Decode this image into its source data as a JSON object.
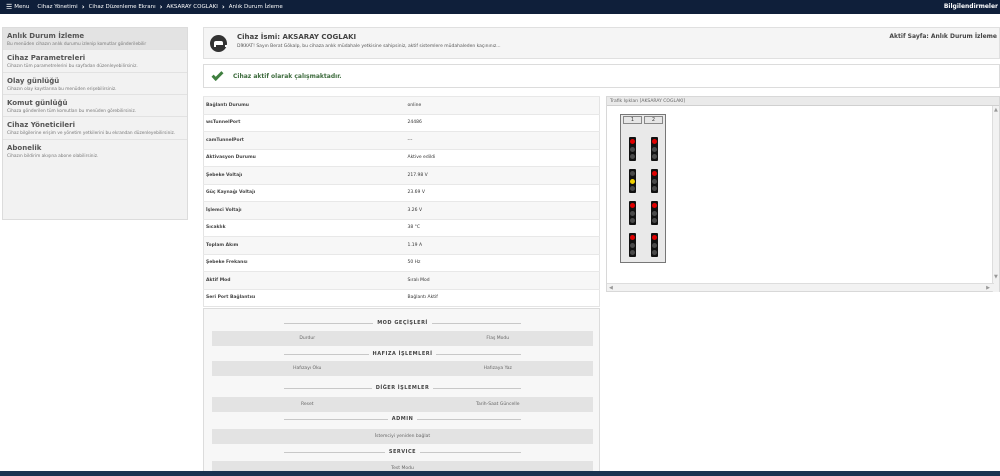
{
  "topbar": {
    "menu_label": "Menu",
    "breadcrumbs": [
      "Cihaz Yönetimi",
      "Cihaz Düzenleme Ekranı",
      "AKSARAY COGLAKI",
      "Anlık Durum İzleme"
    ],
    "notifications_label": "Bilgilendirmeler"
  },
  "sidebar": {
    "items": [
      {
        "title": "Anlık Durum İzleme",
        "desc": "Bu menüden cihazın anlık durumu izlenip komutlar gönderilebilir"
      },
      {
        "title": "Cihaz Parametreleri",
        "desc": "Cihazın tüm parametrelerini bu sayfadan düzenleyebilirsiniz."
      },
      {
        "title": "Olay günlüğü",
        "desc": "Cihazın olay kayıtlarına bu menüden erişebilirsiniz."
      },
      {
        "title": "Komut günlüğü",
        "desc": "Cihaza gönderilen tüm komutları bu menüden görebilirsiniz."
      },
      {
        "title": "Cihaz Yöneticileri",
        "desc": "Cihaz bilgilerine erişim ve yönetim yetkilerini bu ekrandan düzenleyebilirsiniz."
      },
      {
        "title": "Abonelik",
        "desc": "Cihazın bildirim akışına abone olabilirsiniz."
      }
    ]
  },
  "device": {
    "name": "Cihaz İsmi: AKSARAY COGLAKI",
    "warning": "DİKKAT! Sayın Berat Gökalp, bu cihaza anlık müdahale yetkisine sahipsiniz, aktif sistemlere müdahaleden kaçınınız...",
    "active_page": "Aktif Sayfa: Anlık Durum İzleme"
  },
  "alert": {
    "text": "Cihaz aktif olarak çalışmaktadır."
  },
  "status": [
    {
      "key": "Bağlantı Durumu",
      "value": "online"
    },
    {
      "key": "wsTunnelPort",
      "value": "24486"
    },
    {
      "key": "camTunnelPort",
      "value": "---"
    },
    {
      "key": "Aktivasyon Durumu",
      "value": "Aktive edildi"
    },
    {
      "key": "Şebeke Voltajı",
      "value": "217.98 V"
    },
    {
      "key": "Güç Kaynağı Voltajı",
      "value": "23.69 V"
    },
    {
      "key": "İşlemci Voltajı",
      "value": "3.26 V"
    },
    {
      "key": "Sıcaklık",
      "value": "38 °C"
    },
    {
      "key": "Toplam Akım",
      "value": "1.19 A"
    },
    {
      "key": "Şebeke Frekansı",
      "value": "50 Hz"
    },
    {
      "key": "Aktif Mod",
      "value": "Sıralı Mod"
    },
    {
      "key": "Seri Port Bağlantısı",
      "value": "Bağlantı Aktif"
    }
  ],
  "traffic": {
    "title": "Trafik Işıkları [AKSARAY COGLAKI]",
    "columns": [
      "1",
      "2"
    ],
    "signals": {
      "col1": [
        [
          "red",
          "off",
          "off"
        ],
        [
          "off",
          "yellow",
          "off"
        ],
        [
          "red",
          "off",
          "off"
        ],
        [
          "red",
          "off",
          "off"
        ]
      ],
      "col2": [
        [
          "red",
          "off",
          "off"
        ],
        [
          "red",
          "off",
          "off"
        ],
        [
          "red",
          "off",
          "off"
        ],
        [
          "red",
          "off",
          "off"
        ]
      ]
    }
  },
  "controls": {
    "mode_title": "MOD GEÇİŞLERİ",
    "stop": "Durdur",
    "flash": "Flaş Modu",
    "memory_title": "HAFIZA İŞLEMLERİ",
    "read_memory": "Hafızayı Oku",
    "write_memory": "Hafızaya Yaz",
    "other_title": "DİĞER İŞLEMLER",
    "reset": "Reset",
    "update_datetime": "Tarih-Saat Güncelle",
    "admin_title": "ADMIN",
    "reconnect": "İstemciyi yeniden bağlat",
    "service_title": "SERVICE",
    "test_mode": "Test Modu"
  }
}
